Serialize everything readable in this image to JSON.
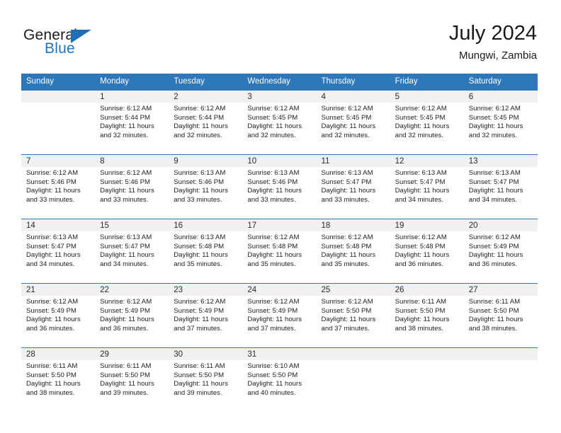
{
  "brand": {
    "name_part1": "General",
    "name_part2": "Blue",
    "logo_icon": "triangle-logo-icon",
    "accent_color": "#1e73be"
  },
  "header": {
    "title": "July 2024",
    "subtitle": "Mungwi, Zambia"
  },
  "theme": {
    "header_row_background": "#2e77b8",
    "week_separator": "#2e77b8",
    "daynum_band_background": "#f1f1f1",
    "text_color": "#222222"
  },
  "weekdays": [
    "Sunday",
    "Monday",
    "Tuesday",
    "Wednesday",
    "Thursday",
    "Friday",
    "Saturday"
  ],
  "labels": {
    "sunrise_prefix": "Sunrise:",
    "sunset_prefix": "Sunset:",
    "daylight_prefix": "Daylight:"
  },
  "weeks": [
    [
      {
        "day": "",
        "sunrise": "",
        "sunset": "",
        "daylight_line1": "",
        "daylight_line2": ""
      },
      {
        "day": "1",
        "sunrise": "Sunrise: 6:12 AM",
        "sunset": "Sunset: 5:44 PM",
        "daylight_line1": "Daylight: 11 hours",
        "daylight_line2": "and 32 minutes."
      },
      {
        "day": "2",
        "sunrise": "Sunrise: 6:12 AM",
        "sunset": "Sunset: 5:44 PM",
        "daylight_line1": "Daylight: 11 hours",
        "daylight_line2": "and 32 minutes."
      },
      {
        "day": "3",
        "sunrise": "Sunrise: 6:12 AM",
        "sunset": "Sunset: 5:45 PM",
        "daylight_line1": "Daylight: 11 hours",
        "daylight_line2": "and 32 minutes."
      },
      {
        "day": "4",
        "sunrise": "Sunrise: 6:12 AM",
        "sunset": "Sunset: 5:45 PM",
        "daylight_line1": "Daylight: 11 hours",
        "daylight_line2": "and 32 minutes."
      },
      {
        "day": "5",
        "sunrise": "Sunrise: 6:12 AM",
        "sunset": "Sunset: 5:45 PM",
        "daylight_line1": "Daylight: 11 hours",
        "daylight_line2": "and 32 minutes."
      },
      {
        "day": "6",
        "sunrise": "Sunrise: 6:12 AM",
        "sunset": "Sunset: 5:45 PM",
        "daylight_line1": "Daylight: 11 hours",
        "daylight_line2": "and 32 minutes."
      }
    ],
    [
      {
        "day": "7",
        "sunrise": "Sunrise: 6:12 AM",
        "sunset": "Sunset: 5:46 PM",
        "daylight_line1": "Daylight: 11 hours",
        "daylight_line2": "and 33 minutes."
      },
      {
        "day": "8",
        "sunrise": "Sunrise: 6:12 AM",
        "sunset": "Sunset: 5:46 PM",
        "daylight_line1": "Daylight: 11 hours",
        "daylight_line2": "and 33 minutes."
      },
      {
        "day": "9",
        "sunrise": "Sunrise: 6:13 AM",
        "sunset": "Sunset: 5:46 PM",
        "daylight_line1": "Daylight: 11 hours",
        "daylight_line2": "and 33 minutes."
      },
      {
        "day": "10",
        "sunrise": "Sunrise: 6:13 AM",
        "sunset": "Sunset: 5:46 PM",
        "daylight_line1": "Daylight: 11 hours",
        "daylight_line2": "and 33 minutes."
      },
      {
        "day": "11",
        "sunrise": "Sunrise: 6:13 AM",
        "sunset": "Sunset: 5:47 PM",
        "daylight_line1": "Daylight: 11 hours",
        "daylight_line2": "and 33 minutes."
      },
      {
        "day": "12",
        "sunrise": "Sunrise: 6:13 AM",
        "sunset": "Sunset: 5:47 PM",
        "daylight_line1": "Daylight: 11 hours",
        "daylight_line2": "and 34 minutes."
      },
      {
        "day": "13",
        "sunrise": "Sunrise: 6:13 AM",
        "sunset": "Sunset: 5:47 PM",
        "daylight_line1": "Daylight: 11 hours",
        "daylight_line2": "and 34 minutes."
      }
    ],
    [
      {
        "day": "14",
        "sunrise": "Sunrise: 6:13 AM",
        "sunset": "Sunset: 5:47 PM",
        "daylight_line1": "Daylight: 11 hours",
        "daylight_line2": "and 34 minutes."
      },
      {
        "day": "15",
        "sunrise": "Sunrise: 6:13 AM",
        "sunset": "Sunset: 5:47 PM",
        "daylight_line1": "Daylight: 11 hours",
        "daylight_line2": "and 34 minutes."
      },
      {
        "day": "16",
        "sunrise": "Sunrise: 6:13 AM",
        "sunset": "Sunset: 5:48 PM",
        "daylight_line1": "Daylight: 11 hours",
        "daylight_line2": "and 35 minutes."
      },
      {
        "day": "17",
        "sunrise": "Sunrise: 6:12 AM",
        "sunset": "Sunset: 5:48 PM",
        "daylight_line1": "Daylight: 11 hours",
        "daylight_line2": "and 35 minutes."
      },
      {
        "day": "18",
        "sunrise": "Sunrise: 6:12 AM",
        "sunset": "Sunset: 5:48 PM",
        "daylight_line1": "Daylight: 11 hours",
        "daylight_line2": "and 35 minutes."
      },
      {
        "day": "19",
        "sunrise": "Sunrise: 6:12 AM",
        "sunset": "Sunset: 5:48 PM",
        "daylight_line1": "Daylight: 11 hours",
        "daylight_line2": "and 36 minutes."
      },
      {
        "day": "20",
        "sunrise": "Sunrise: 6:12 AM",
        "sunset": "Sunset: 5:49 PM",
        "daylight_line1": "Daylight: 11 hours",
        "daylight_line2": "and 36 minutes."
      }
    ],
    [
      {
        "day": "21",
        "sunrise": "Sunrise: 6:12 AM",
        "sunset": "Sunset: 5:49 PM",
        "daylight_line1": "Daylight: 11 hours",
        "daylight_line2": "and 36 minutes."
      },
      {
        "day": "22",
        "sunrise": "Sunrise: 6:12 AM",
        "sunset": "Sunset: 5:49 PM",
        "daylight_line1": "Daylight: 11 hours",
        "daylight_line2": "and 36 minutes."
      },
      {
        "day": "23",
        "sunrise": "Sunrise: 6:12 AM",
        "sunset": "Sunset: 5:49 PM",
        "daylight_line1": "Daylight: 11 hours",
        "daylight_line2": "and 37 minutes."
      },
      {
        "day": "24",
        "sunrise": "Sunrise: 6:12 AM",
        "sunset": "Sunset: 5:49 PM",
        "daylight_line1": "Daylight: 11 hours",
        "daylight_line2": "and 37 minutes."
      },
      {
        "day": "25",
        "sunrise": "Sunrise: 6:12 AM",
        "sunset": "Sunset: 5:50 PM",
        "daylight_line1": "Daylight: 11 hours",
        "daylight_line2": "and 37 minutes."
      },
      {
        "day": "26",
        "sunrise": "Sunrise: 6:11 AM",
        "sunset": "Sunset: 5:50 PM",
        "daylight_line1": "Daylight: 11 hours",
        "daylight_line2": "and 38 minutes."
      },
      {
        "day": "27",
        "sunrise": "Sunrise: 6:11 AM",
        "sunset": "Sunset: 5:50 PM",
        "daylight_line1": "Daylight: 11 hours",
        "daylight_line2": "and 38 minutes."
      }
    ],
    [
      {
        "day": "28",
        "sunrise": "Sunrise: 6:11 AM",
        "sunset": "Sunset: 5:50 PM",
        "daylight_line1": "Daylight: 11 hours",
        "daylight_line2": "and 38 minutes."
      },
      {
        "day": "29",
        "sunrise": "Sunrise: 6:11 AM",
        "sunset": "Sunset: 5:50 PM",
        "daylight_line1": "Daylight: 11 hours",
        "daylight_line2": "and 39 minutes."
      },
      {
        "day": "30",
        "sunrise": "Sunrise: 6:11 AM",
        "sunset": "Sunset: 5:50 PM",
        "daylight_line1": "Daylight: 11 hours",
        "daylight_line2": "and 39 minutes."
      },
      {
        "day": "31",
        "sunrise": "Sunrise: 6:10 AM",
        "sunset": "Sunset: 5:50 PM",
        "daylight_line1": "Daylight: 11 hours",
        "daylight_line2": "and 40 minutes."
      },
      {
        "day": "",
        "sunrise": "",
        "sunset": "",
        "daylight_line1": "",
        "daylight_line2": ""
      },
      {
        "day": "",
        "sunrise": "",
        "sunset": "",
        "daylight_line1": "",
        "daylight_line2": ""
      },
      {
        "day": "",
        "sunrise": "",
        "sunset": "",
        "daylight_line1": "",
        "daylight_line2": ""
      }
    ]
  ]
}
